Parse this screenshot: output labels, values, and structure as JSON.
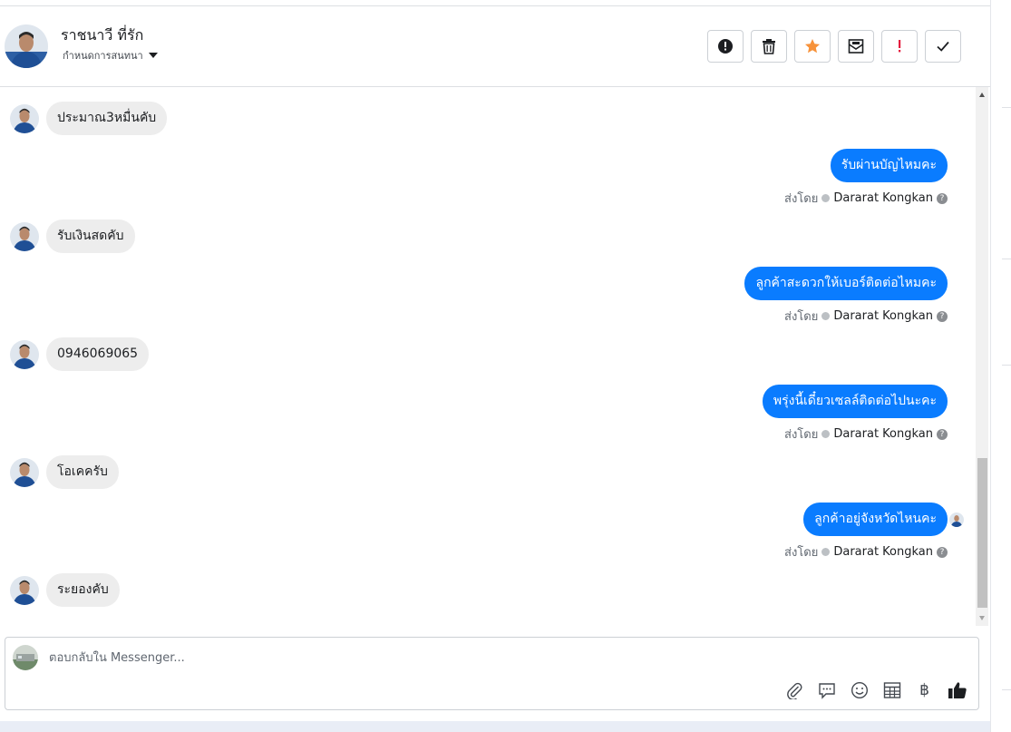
{
  "header": {
    "contact_name": "ราชนาวี ที่รัก",
    "assign_label": "กำหนดการสนทนา",
    "actions": [
      {
        "name": "spam-button",
        "icon": "alert-circle-icon"
      },
      {
        "name": "delete-button",
        "icon": "trash-icon"
      },
      {
        "name": "star-button",
        "icon": "star-icon",
        "color": "#f7923a"
      },
      {
        "name": "mark-unread-button",
        "icon": "envelope-icon"
      },
      {
        "name": "important-button",
        "icon": "exclamation-icon",
        "color": "#e41e3f"
      },
      {
        "name": "done-button",
        "icon": "check-icon"
      }
    ]
  },
  "messages": [
    {
      "dir": "in",
      "text": "ประมาณ3หมื่นคับ"
    },
    {
      "dir": "out",
      "text": "รับผ่านบัญไหมคะ",
      "sent_prefix": "ส่งโดย",
      "agent": "Dararat Kongkan"
    },
    {
      "dir": "in",
      "text": "รับเงินสดคับ"
    },
    {
      "dir": "out",
      "text": "ลูกค้าสะดวกให้เบอร์ติดต่อไหมคะ",
      "sent_prefix": "ส่งโดย",
      "agent": "Dararat Kongkan"
    },
    {
      "dir": "in",
      "text": "0946069065"
    },
    {
      "dir": "out",
      "text": "พรุ่งนี้เดี๋ยวเซลล์ติดต่อไปนะคะ",
      "sent_prefix": "ส่งโดย",
      "agent": "Dararat Kongkan"
    },
    {
      "dir": "in",
      "text": "โอเคครับ"
    },
    {
      "dir": "out",
      "text": "ลูกค้าอยู่จังหวัดไหนคะ",
      "sent_prefix": "ส่งโดย",
      "agent": "Dararat Kongkan"
    },
    {
      "dir": "in",
      "text": "ระยองคับ"
    }
  ],
  "composer": {
    "placeholder": "ตอบกลับใน Messenger...",
    "tools": [
      "paperclip-icon",
      "saved-reply-icon",
      "emoji-icon",
      "table-icon",
      "baht-icon",
      "thumbs-up-icon"
    ],
    "baht_symbol": "฿"
  },
  "colors": {
    "outgoing_bubble": "#0a7cff",
    "incoming_bubble": "#ededed"
  }
}
